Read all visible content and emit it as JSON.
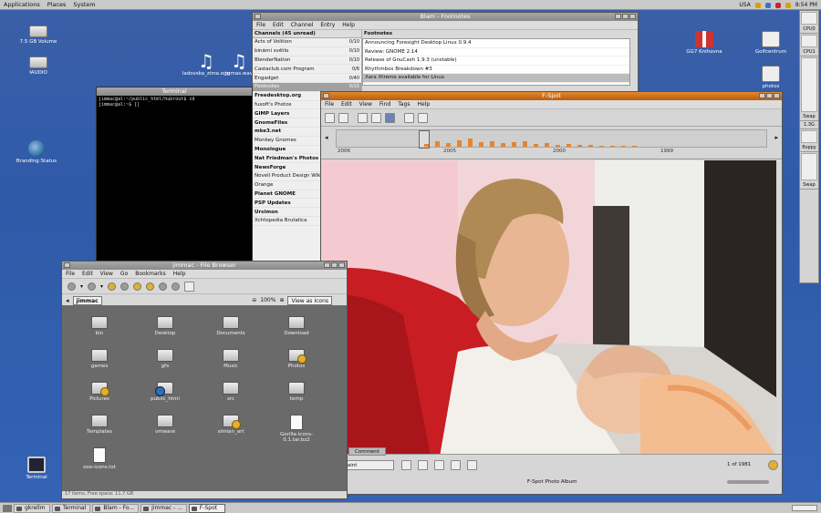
{
  "top_panel": {
    "menus": [
      "Applications",
      "Places",
      "System"
    ],
    "locale": "USA",
    "clock": "8:54 PM"
  },
  "desktop_icons": [
    {
      "label": "7.5 GB Volume",
      "icon": "drive-icon"
    },
    {
      "label": "IAUDIO",
      "icon": "drive-icon"
    },
    {
      "label": "ladovska_zima.ogg",
      "icon": "music-note-icon"
    },
    {
      "label": "tomas.wav",
      "icon": "music-note-icon"
    },
    {
      "label": "Branding Status",
      "icon": "globe-icon"
    },
    {
      "label": "Terminal",
      "icon": "terminal-icon"
    },
    {
      "label": "GG7 Knihovna",
      "icon": "flag-icon"
    },
    {
      "label": "Golfcentrum",
      "icon": "camera-icon"
    },
    {
      "label": "photos",
      "icon": "camera-icon"
    }
  ],
  "blam": {
    "title": "Blam - Footnotes",
    "menu": [
      "File",
      "Edit",
      "Channel",
      "Entry",
      "Help"
    ],
    "channels_header": "Channels (45 unread)",
    "footnotes_header": "Footnotes",
    "channels": [
      {
        "name": "Acts of Volition",
        "count": "0/10",
        "bold": false
      },
      {
        "name": "binární světlo",
        "count": "0/10",
        "bold": false
      },
      {
        "name": "BlenderNation",
        "count": "0/10",
        "bold": false
      },
      {
        "name": "Castaclub.com Program",
        "count": "0/6",
        "bold": false
      },
      {
        "name": "Engadget",
        "count": "0/40",
        "bold": false
      },
      {
        "name": "Footnotes",
        "count": "0/15",
        "bold": false,
        "selected": true
      },
      {
        "name": "Freedesktop.org",
        "count": "",
        "bold": true
      },
      {
        "name": "fuxoft's Photos",
        "count": "",
        "bold": false
      },
      {
        "name": "GIMP Layers",
        "count": "",
        "bold": true
      },
      {
        "name": "GnomeFiles",
        "count": "",
        "bold": true
      },
      {
        "name": "mke3.net",
        "count": "",
        "bold": true
      },
      {
        "name": "Monkey Gnomes",
        "count": "",
        "bold": false
      },
      {
        "name": "Monologue",
        "count": "",
        "bold": true
      },
      {
        "name": "Nat Friedman's Photos",
        "count": "",
        "bold": true
      },
      {
        "name": "NewsForge",
        "count": "",
        "bold": true
      },
      {
        "name": "Novell Product Design Wiki",
        "count": "",
        "bold": false
      },
      {
        "name": "Orange",
        "count": "",
        "bold": false
      },
      {
        "name": "Planet GNOME",
        "count": "",
        "bold": true
      },
      {
        "name": "PSP Updates",
        "count": "",
        "bold": true
      },
      {
        "name": "Ursimon",
        "count": "",
        "bold": true
      },
      {
        "name": "Xchtopedia Brutalica",
        "count": "",
        "bold": false
      }
    ],
    "footnotes": [
      {
        "title": "Announcing Foresight Desktop Linux 0.9.4"
      },
      {
        "title": "Review: GNOME 2.14"
      },
      {
        "title": "Release of GnuCash 1.9.3 (unstable)"
      },
      {
        "title": "Rhythmbox Breakdown #3"
      },
      {
        "title": "Xara Xtreme available for Linux",
        "selected": true
      }
    ]
  },
  "terminal": {
    "title": "Terminal",
    "lines": [
      "jimmac@al:~/public_html/hubrout$ cd",
      "jimmac@al:~$ []"
    ]
  },
  "fspot": {
    "title": "F-Spot",
    "menu": [
      "File",
      "Edit",
      "View",
      "Find",
      "Tags",
      "Help"
    ],
    "timeline_years": [
      "2006",
      "2005",
      "2000",
      "1999"
    ],
    "timeline_bars": [
      0.15,
      0.3,
      0.2,
      0.35,
      0.45,
      0.25,
      0.3,
      0.2,
      0.25,
      0.3,
      0.15,
      0.2,
      0.1,
      0.15,
      0.1,
      0.1,
      0.05,
      0.05,
      0.05,
      0.05
    ],
    "tab_comment": "Comment",
    "view_select": "Straint",
    "counter": "1 of 1981",
    "album_title": "F-Spot Photo Album"
  },
  "file_browser": {
    "title": "jimmac - File Browser",
    "menu": [
      "File",
      "Edit",
      "View",
      "Go",
      "Bookmarks",
      "Help"
    ],
    "location": "jimmac",
    "zoom": "100%",
    "view_mode": "View as Icons",
    "items": [
      {
        "name": "bin",
        "kind": "folder"
      },
      {
        "name": "Desktop",
        "kind": "folder"
      },
      {
        "name": "Documents",
        "kind": "folder"
      },
      {
        "name": "Download",
        "kind": "folder"
      },
      {
        "name": "games",
        "kind": "folder"
      },
      {
        "name": "gfx",
        "kind": "folder"
      },
      {
        "name": "Music",
        "kind": "folder"
      },
      {
        "name": "Photos",
        "kind": "folder-emblem"
      },
      {
        "name": "Pictures",
        "kind": "folder-emblem"
      },
      {
        "name": "public_html",
        "kind": "folder-web"
      },
      {
        "name": "src",
        "kind": "folder"
      },
      {
        "name": "temp",
        "kind": "folder"
      },
      {
        "name": "Templates",
        "kind": "folder"
      },
      {
        "name": "vmware",
        "kind": "folder"
      },
      {
        "name": "ximian_art",
        "kind": "folder-emblem"
      },
      {
        "name": "Gorilla-icons-0.1.tar.bz2",
        "kind": "file"
      },
      {
        "name": "ooo-icons.txt",
        "kind": "file"
      }
    ],
    "status": "17 items, Free space: 11.7 GB"
  },
  "gkrellm": {
    "labels": [
      "CPU0",
      "CPU1",
      "Swap",
      "1.3G",
      "floppy",
      "Swap"
    ]
  },
  "taskbar": [
    {
      "label": "gkrellm",
      "active": false
    },
    {
      "label": "Terminal",
      "active": false
    },
    {
      "label": "Blam - Fo...",
      "active": false
    },
    {
      "label": "jimmac - ...",
      "active": false
    },
    {
      "label": "F-Spot",
      "active": true
    }
  ]
}
